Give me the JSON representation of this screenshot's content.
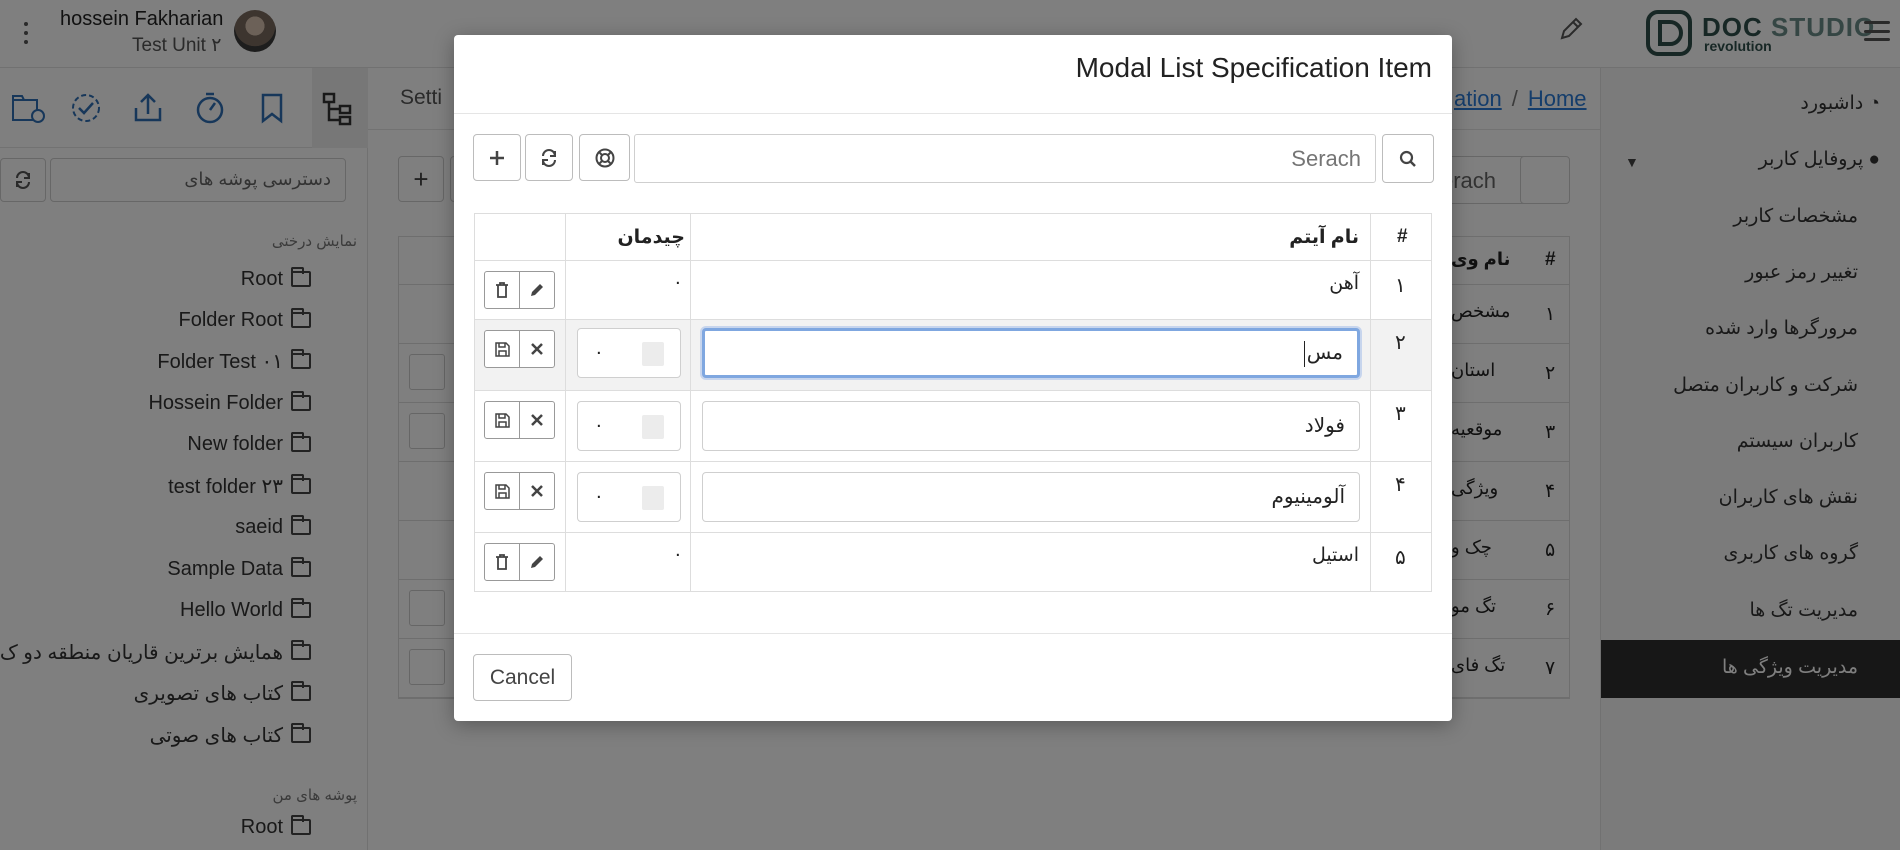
{
  "header": {
    "user_name": "hossein Fakharian",
    "user_unit": "Test Unit ۲",
    "brand_title_a": "DOC",
    "brand_title_b": "STUDIO",
    "brand_subtitle": "revolution"
  },
  "left_panel": {
    "toolbar_icons": [
      "shared-folder-icon",
      "check-circle-icon",
      "share-icon",
      "timer-icon",
      "bookmark-icon",
      "tree-structure-icon"
    ],
    "access_input_value": "دسترسی پوشه های",
    "tree_view_label": "نمایش درختی",
    "tree_items": [
      "Root",
      "Folder Root",
      "Folder Test ۰۱",
      "Hossein Folder",
      "New folder",
      "test folder ۲۳",
      "saeid",
      "Sample Data",
      "Hello World",
      "همایش برترین قاریان منطقه دو ک...",
      "کتاب های تصویری",
      "کتاب های صوتی"
    ],
    "my_folders_label": "پوشه های من",
    "my_root": "Root"
  },
  "main": {
    "tab_label": "Setti",
    "breadcrumb_prev": "ation",
    "breadcrumb_sep": "/",
    "breadcrumb_home": "Home",
    "search_text": "erach",
    "rows": [
      {
        "num": "۱",
        "text": "مشخص"
      },
      {
        "num": "۲",
        "text": "استان"
      },
      {
        "num": "۳",
        "text": "موقعیه"
      },
      {
        "num": "۴",
        "text": "ویژگی"
      },
      {
        "num": "۵",
        "text": "چک و"
      },
      {
        "num": "۶",
        "text": "تگ مو"
      },
      {
        "num": "۷",
        "text": "تگ فای"
      }
    ],
    "header_partial": "نام وی",
    "header_num": "#"
  },
  "sidebar": {
    "items": [
      "داشبورد",
      "پروفایل کاربر",
      "مشخصات کاربر",
      "تغییر رمز عبور",
      "مرورگرها وارد شده",
      "شرکت و کاربران متصل",
      "کاربران سیستم",
      "نقش های کاربران",
      "گروه های کاربری",
      "مدیریت تگ ها",
      "مدیریت ویژگی ها"
    ]
  },
  "modal": {
    "title": "Modal List Specification Item",
    "search_placeholder": "Serach",
    "columns": {
      "num": "#",
      "name": "نام آیتم",
      "order": "چیدمان"
    },
    "rows": [
      {
        "num": "۱",
        "name": "آهن",
        "order": "۰",
        "mode": "view"
      },
      {
        "num": "۲",
        "name": "مس",
        "order": "۰",
        "mode": "edit"
      },
      {
        "num": "۳",
        "name": "فولاد",
        "order": "۰",
        "mode": "edit"
      },
      {
        "num": "۴",
        "name": "آلومینیوم",
        "order": "۰",
        "mode": "edit"
      },
      {
        "num": "۵",
        "name": "استیل",
        "order": "۰",
        "mode": "view"
      }
    ],
    "cancel_label": "Cancel"
  }
}
